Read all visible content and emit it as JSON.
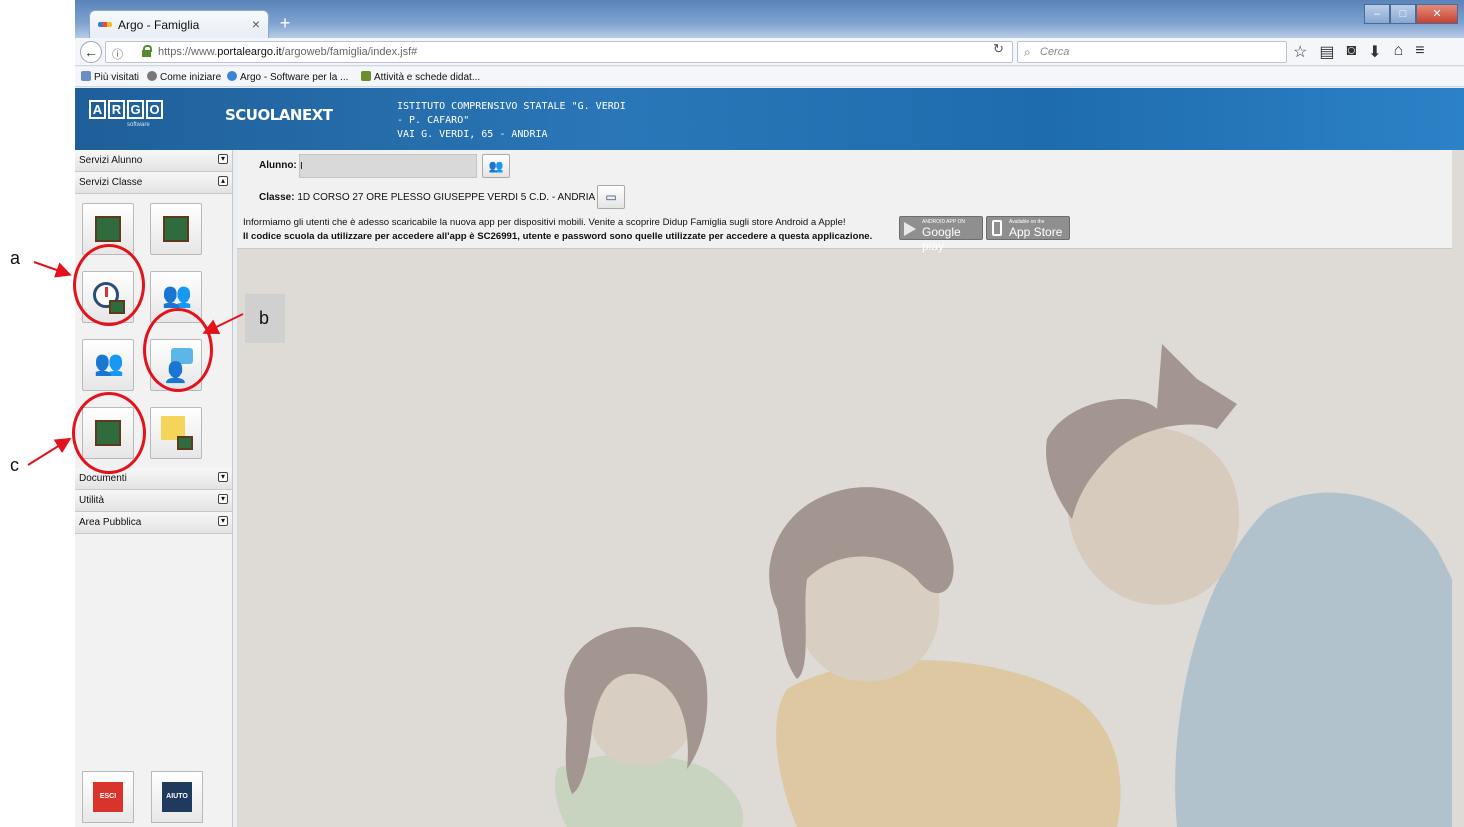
{
  "browser": {
    "tab_title": "Argo - Famiglia",
    "tab_close": "×",
    "new_tab": "+",
    "url_prefix": "https://www.",
    "url_domain": "portaleargo.it",
    "url_path": "/argoweb/famiglia/index.jsf#",
    "search_placeholder": "Cerca",
    "bookmarks": [
      "Più visitati",
      "Come iniziare",
      "Argo - Software per la ...",
      "Attività e schede didat..."
    ]
  },
  "header": {
    "logo_letters": [
      "A",
      "R",
      "G",
      "O"
    ],
    "logo_sub": "software",
    "product": "SCUOLANEXT",
    "school_line1": "ISTITUTO COMPRENSIVO STATALE \"G. VERDI",
    "school_line2": "- P. CAFARO\"",
    "school_line3": "VAI G. VERDI, 65 - ANDRIA"
  },
  "sidebar": {
    "sections": [
      {
        "label": "Servizi Alunno",
        "toggle": "▾"
      },
      {
        "label": "Servizi Classe",
        "toggle": "▴"
      },
      {
        "label": "Documenti",
        "toggle": "▾"
      },
      {
        "label": "Utilità",
        "toggle": "▾"
      },
      {
        "label": "Area Pubblica",
        "toggle": "▾"
      }
    ],
    "exit_label": "ESCI",
    "help_label": "AIUTO"
  },
  "infobar": {
    "alunno_label": "Alunno:",
    "alunno_value": "I",
    "classe_label": "Classe:",
    "classe_value": "1D CORSO 27 ORE PLESSO GIUSEPPE VERDI 5 C.D. - ANDRIA",
    "info_line1": "Informiamo gli utenti che è adesso scaricabile la nuova app per dispositivi mobili. Venite a scoprire Didup Famiglia sugli store Android a Apple!",
    "info_line2": "Il codice scuola da utilizzare per accedere all'app è SC26991, utente e password sono quelle utilizzate per accedere a questa applicazione.",
    "google_small": "ANDROID APP ON",
    "google_big": "Google play",
    "apple_small": "Available on the",
    "apple_big": "App Store"
  },
  "annotations": {
    "a": "a",
    "b": "b",
    "c": "c"
  },
  "colors": {
    "header_blue": "#1f6cad",
    "annotation_red": "#e3121b",
    "exit_red": "#d9342b",
    "help_navy": "#1f3a5c"
  }
}
